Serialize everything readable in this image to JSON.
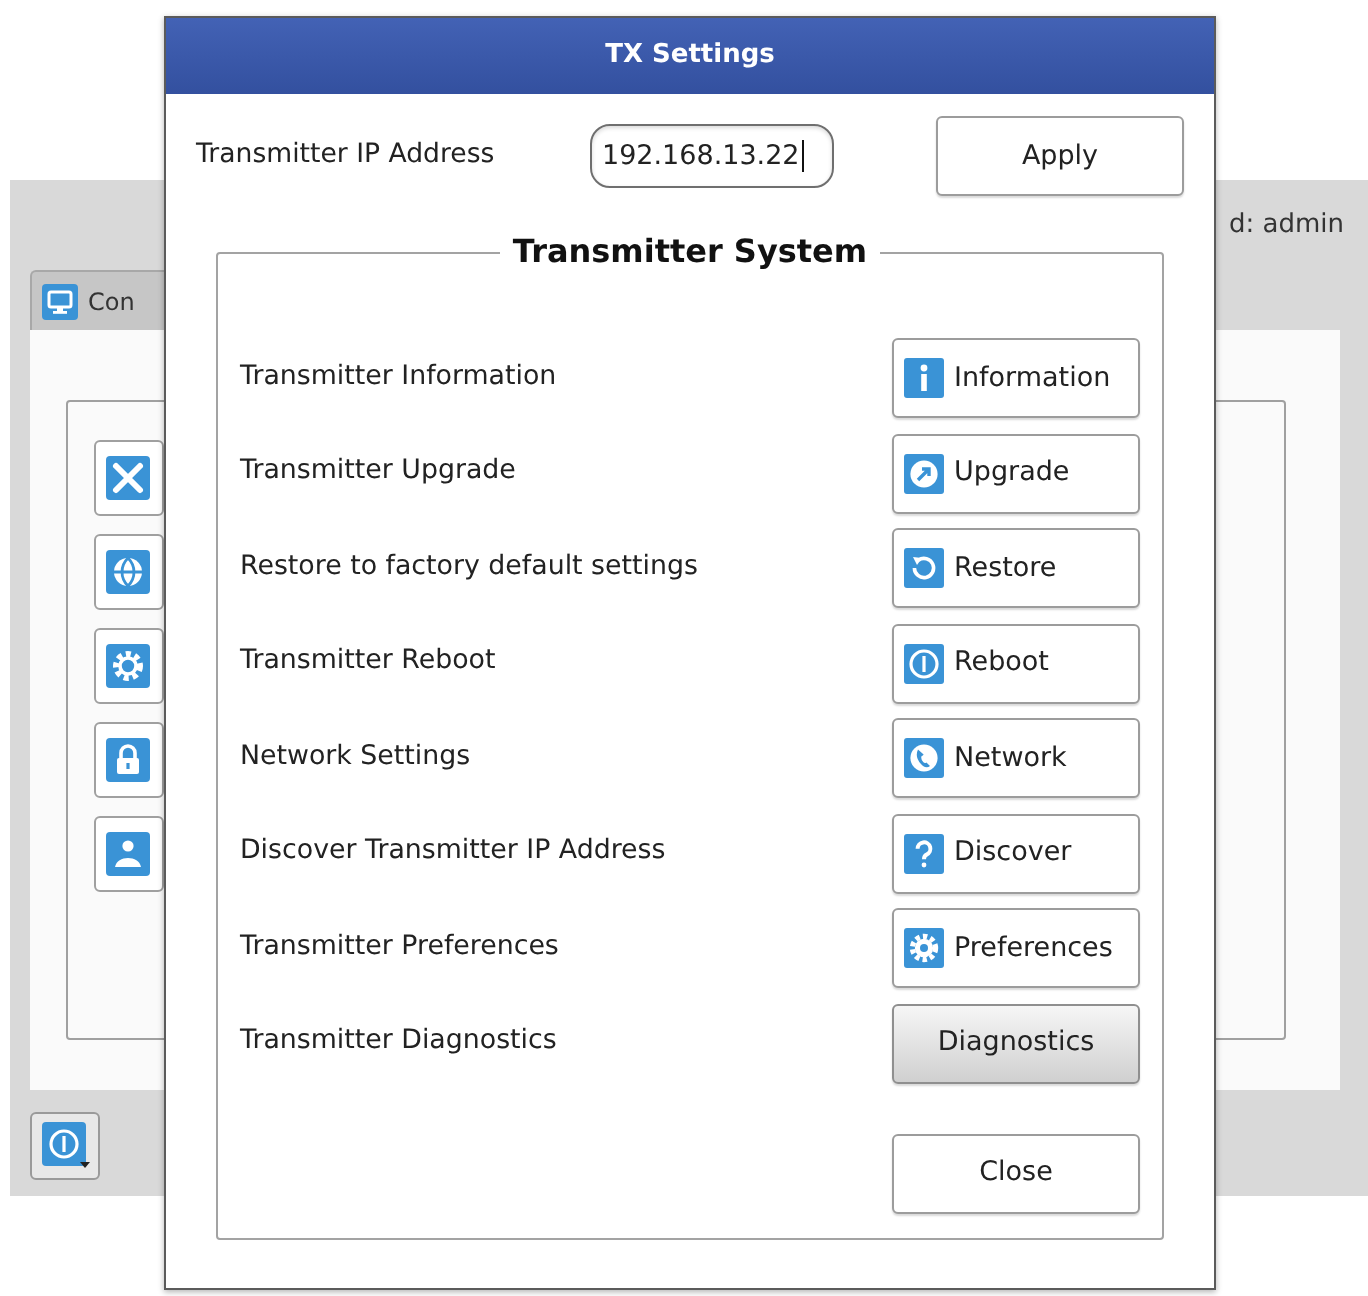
{
  "background_window": {
    "tab": {
      "label": "Con"
    },
    "user_label": "d: admin"
  },
  "dialog": {
    "title": "TX Settings",
    "ip_address": {
      "label": "Transmitter IP Address",
      "value": "192.168.13.22",
      "focused": true
    },
    "apply_button": "Apply",
    "group": {
      "title": "Transmitter System",
      "rows": [
        {
          "label": "Transmitter Information",
          "button": {
            "label": "Information",
            "kind": "information",
            "highlighted": false
          }
        },
        {
          "label": "Transmitter Upgrade",
          "button": {
            "label": "Upgrade",
            "kind": "upgrade",
            "highlighted": false
          }
        },
        {
          "label": "Restore to factory default settings",
          "button": {
            "label": "Restore",
            "kind": "restore",
            "highlighted": false
          }
        },
        {
          "label": "Transmitter Reboot",
          "button": {
            "label": "Reboot",
            "kind": "reboot",
            "highlighted": false
          }
        },
        {
          "label": "Network Settings",
          "button": {
            "label": "Network",
            "kind": "network",
            "highlighted": false
          }
        },
        {
          "label": "Discover Transmitter IP Address",
          "button": {
            "label": "Discover",
            "kind": "discover",
            "highlighted": false
          }
        },
        {
          "label": "Transmitter Preferences",
          "button": {
            "label": "Preferences",
            "kind": "preferences",
            "highlighted": false
          }
        },
        {
          "label": "Transmitter Diagnostics",
          "button": {
            "label": "Diagnostics",
            "kind": "plain",
            "highlighted": true
          }
        }
      ]
    },
    "close_button": "Close"
  }
}
